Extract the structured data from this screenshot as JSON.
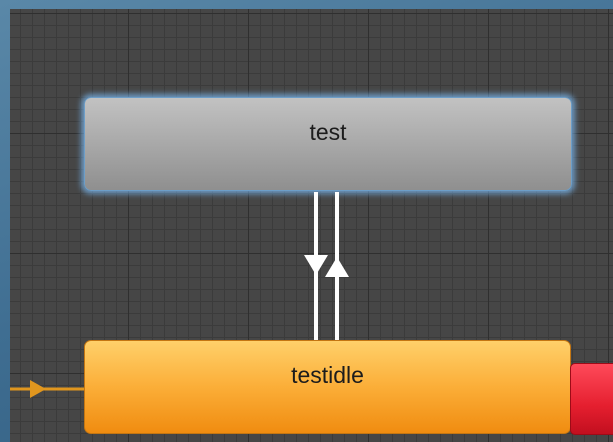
{
  "graph": {
    "states": [
      {
        "id": "test",
        "label": "test",
        "selected": true
      },
      {
        "id": "testidle",
        "label": "testidle",
        "default": true
      }
    ]
  },
  "colors": {
    "canvas": "#464646",
    "grid_major": "#2f2f2f",
    "grid_minor": "#3b3b3b",
    "state_normal": "#a6a6a6",
    "state_default": "#fbae38",
    "selection_glow": "#78b4eb",
    "entry_transition": "#e0961e",
    "transition": "#ffffff",
    "state_exit": "#e51f2f"
  }
}
